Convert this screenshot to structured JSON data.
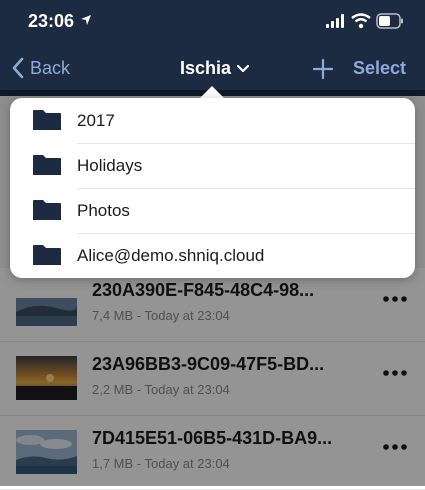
{
  "status_bar": {
    "time": "23:06"
  },
  "nav": {
    "back_label": "Back",
    "title": "Ischia",
    "select_label": "Select"
  },
  "dropdown": {
    "items": [
      {
        "label": "2017"
      },
      {
        "label": "Holidays"
      },
      {
        "label": "Photos"
      },
      {
        "label": "Alice@demo.shniq.cloud"
      }
    ]
  },
  "files": [
    {
      "name": "230A390E-F845-48C4-98...",
      "meta": "7,4 MB - Today at 23:04"
    },
    {
      "name": "23A96BB3-9C09-47F5-BD...",
      "meta": "2,2 MB - Today at 23:04"
    },
    {
      "name": "7D415E51-06B5-431D-BA9...",
      "meta": "1,7 MB - Today at 23:04"
    }
  ],
  "colors": {
    "nav_bg": "#1c2b42",
    "accent": "#8fa9d9",
    "folder": "#1c2b42"
  }
}
